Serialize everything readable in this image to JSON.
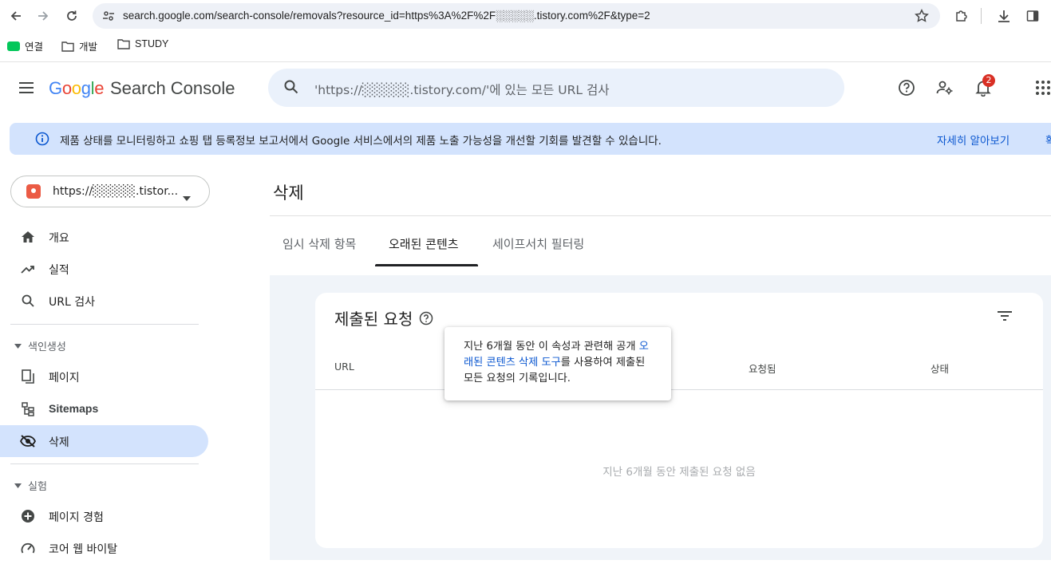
{
  "browser": {
    "url": "search.google.com/search-console/removals?resource_id=https%3A%2F%2F░░░░░.tistory.com%2F&type=2",
    "bookmarks": [
      {
        "label": "연결",
        "icon": "blog-icon"
      },
      {
        "label": "개발",
        "icon": "folder-icon"
      },
      {
        "label": "STUDY",
        "icon": "folder-icon"
      }
    ]
  },
  "header": {
    "logo_google": "Google",
    "logo_product": "Search Console",
    "search_placeholder": "'https://░░░░░.tistory.com/'에 있는 모든 URL 검사",
    "notification_count": "2"
  },
  "banner": {
    "text": "제품 상태를 모니터링하고 쇼핑 탭 등록정보 보고서에서 Google 서비스에서의 제품 노출 가능성을 개선할 기회를 발견할 수 있습니다.",
    "link": "자세히 알아보기",
    "link2": "확"
  },
  "sidebar": {
    "property": "https://░░░░░.tistor...",
    "items_top": [
      {
        "label": "개요",
        "icon": "home-icon"
      },
      {
        "label": "실적",
        "icon": "trending-up-icon"
      },
      {
        "label": "URL 검사",
        "icon": "search-icon"
      }
    ],
    "section_indexing": "색인생성",
    "items_indexing": [
      {
        "label": "페이지",
        "icon": "pages-icon"
      },
      {
        "label": "Sitemaps",
        "icon": "sitemap-icon"
      },
      {
        "label": "삭제",
        "icon": "visibility-off-icon",
        "active": true
      }
    ],
    "section_experience": "실험",
    "items_experience": [
      {
        "label": "페이지 경험",
        "icon": "plus-circle-icon"
      },
      {
        "label": "코어 웹 바이탈",
        "icon": "speed-icon"
      }
    ]
  },
  "main": {
    "title": "삭제",
    "tabs": [
      {
        "label": "임시 삭제 항목",
        "active": false
      },
      {
        "label": "오래된 콘텐츠",
        "active": true
      },
      {
        "label": "세이프서치 필터링",
        "active": false
      }
    ],
    "card": {
      "title": "제출된 요청",
      "columns": [
        "URL",
        "요청됨",
        "상태"
      ],
      "empty_message": "지난 6개월 동안 제출된 요청 없음"
    },
    "tooltip": {
      "before": "지난 6개월 동안 이 속성과 관련해 공개 ",
      "link": "오래된 콘텐츠 삭제 도구",
      "after": "를 사용하여 제출된 모든 요청의 기록입니다."
    }
  },
  "colors": {
    "accent": "#0b57d0",
    "active_nav": "#d3e3fd",
    "badge": "#d93025"
  }
}
